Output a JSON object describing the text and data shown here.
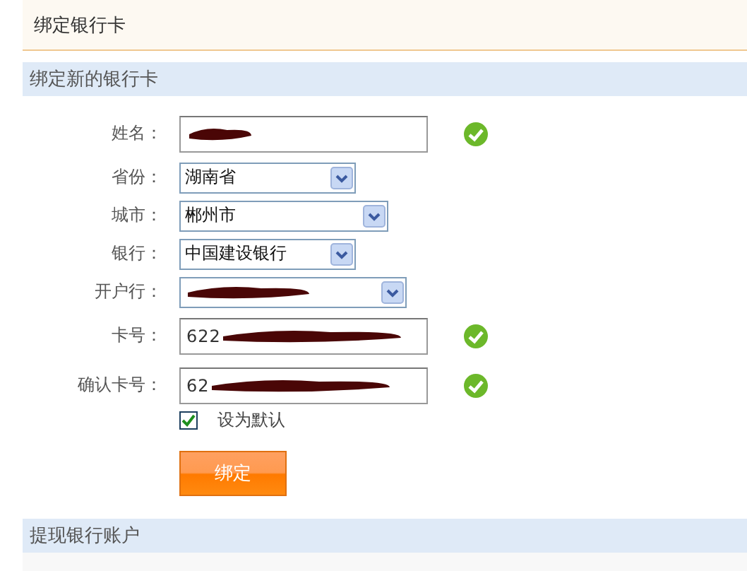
{
  "page_title": "绑定银行卡",
  "sections": [
    {
      "title": "绑定新的银行卡",
      "fields": [
        {
          "kind": "text",
          "label": "姓名：",
          "redacted": true,
          "valid": true
        },
        {
          "kind": "select",
          "label": "省份：",
          "value": "湖南省",
          "redacted": false,
          "valid": false
        },
        {
          "kind": "select",
          "label": "城市：",
          "value": "郴州市",
          "redacted": false,
          "valid": false
        },
        {
          "kind": "select",
          "label": "银行：",
          "value": "中国建设银行",
          "redacted": false,
          "valid": false
        },
        {
          "kind": "select",
          "label": "开户行：",
          "redacted": true,
          "valid": false
        },
        {
          "kind": "text",
          "label": "卡号：",
          "value": "622",
          "redacted": true,
          "valid": true
        },
        {
          "kind": "text",
          "label": "确认卡号：",
          "value": "62",
          "redacted": true,
          "valid": true
        }
      ],
      "default_checkbox": {
        "label": "设为默认",
        "checked": true
      },
      "submit": "绑定"
    },
    {
      "title": "提现银行账户"
    }
  ]
}
